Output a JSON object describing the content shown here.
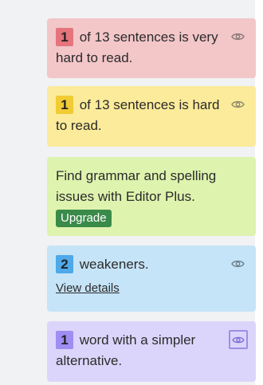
{
  "colors": {
    "background": "#f1f2f4",
    "very_hard_card": "#f3c6c8",
    "hard_card": "#fbeb9a",
    "editor_plus_card": "#def3ae",
    "weakeners_card": "#c6e4f8",
    "simpler_card": "#dcd5fb",
    "upgrade_button": "#3a8a49"
  },
  "cards": {
    "very_hard": {
      "count": "1",
      "text": " of 13 sentences is very hard to read.",
      "icon": "eye-icon"
    },
    "hard": {
      "count": "1",
      "text": " of 13 sentences is hard to read.",
      "icon": "eye-icon"
    },
    "editor_plus": {
      "text": "Find grammar and spelling issues with Editor Plus.",
      "button_label": "Upgrade"
    },
    "weakeners": {
      "count": "2",
      "text": " weakeners.",
      "link_label": "View details",
      "icon": "eye-icon"
    },
    "simpler": {
      "count": "1",
      "text": " word with a simpler alternative.",
      "icon": "eye-icon"
    }
  }
}
